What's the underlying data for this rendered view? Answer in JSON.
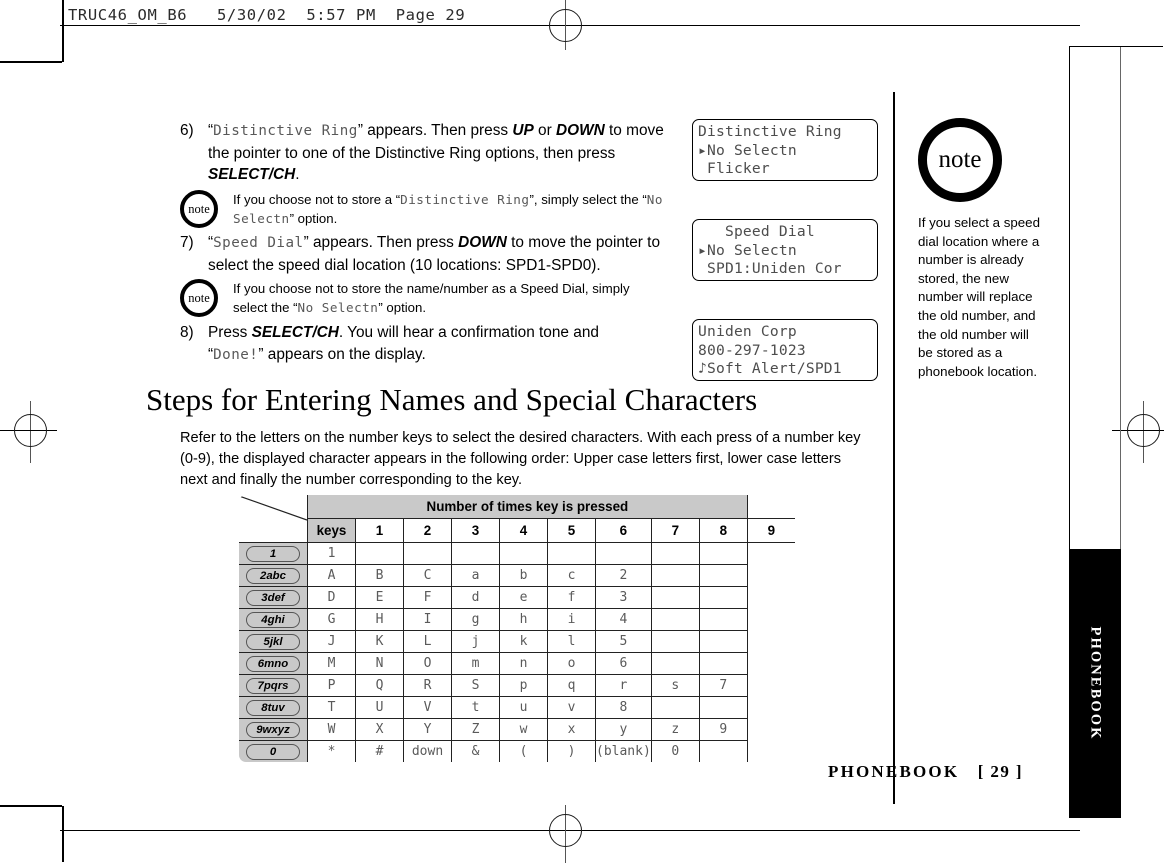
{
  "slug": "TRUC46_OM_B6   5/30/02  5:57 PM  Page 29",
  "steps": [
    {
      "num": "6)",
      "segments": [
        {
          "t": "“",
          "s": "plain"
        },
        {
          "t": "Distinctive Ring",
          "s": "lcd"
        },
        {
          "t": "” appears. Then press ",
          "s": "plain"
        },
        {
          "t": "UP",
          "s": "bolditalic"
        },
        {
          "t": " or ",
          "s": "plain"
        },
        {
          "t": "DOWN",
          "s": "bolditalic"
        },
        {
          "t": " to move the pointer to one of the Distinctive Ring options, then press ",
          "s": "plain"
        },
        {
          "t": "SELECT/CH",
          "s": "bolditalic"
        },
        {
          "t": ".",
          "s": "plain"
        }
      ]
    },
    {
      "num": "7)",
      "segments": [
        {
          "t": "“",
          "s": "plain"
        },
        {
          "t": "Speed Dial",
          "s": "lcd"
        },
        {
          "t": "” appears. Then press ",
          "s": "plain"
        },
        {
          "t": "DOWN",
          "s": "bolditalic"
        },
        {
          "t": " to move the pointer to select the speed dial location (10 locations: SPD1-SPD0).",
          "s": "plain"
        }
      ]
    },
    {
      "num": "8)",
      "segments": [
        {
          "t": "Press ",
          "s": "plain"
        },
        {
          "t": "SELECT/CH",
          "s": "bolditalic"
        },
        {
          "t": ". You will hear a confirmation tone and “",
          "s": "plain"
        },
        {
          "t": "Done!",
          "s": "lcd"
        },
        {
          "t": "” appears on the display.",
          "s": "plain"
        }
      ]
    }
  ],
  "inline_notes": [
    {
      "badge_label": "note",
      "segments": [
        {
          "t": "If you choose not to store a “",
          "s": "plain"
        },
        {
          "t": "Distinctive Ring",
          "s": "lcd"
        },
        {
          "t": "”, simply select the “",
          "s": "plain"
        },
        {
          "t": "No Selectn",
          "s": "lcd"
        },
        {
          "t": "” option.",
          "s": "plain"
        }
      ]
    },
    {
      "badge_label": "note",
      "segments": [
        {
          "t": "If you choose not to store the name/number as a Speed Dial, simply select the “",
          "s": "plain"
        },
        {
          "t": "No Selectn",
          "s": "lcd"
        },
        {
          "t": "” option.",
          "s": "plain"
        }
      ]
    }
  ],
  "lcd_panels": [
    {
      "lines": [
        "Distinctive Ring",
        "▸No Selectn",
        " Flicker"
      ]
    },
    {
      "lines": [
        "   Speed Dial",
        "▸No Selectn",
        " SPD1:Uniden Cor"
      ]
    },
    {
      "lines": [
        "Uniden Corp",
        "800-297-1023",
        "♪Soft Alert/SPD1"
      ]
    }
  ],
  "sidebar_note": {
    "badge_label": "note",
    "text": "If you select a speed dial location where a number is already stored, the new number will replace the old number, and the old number will be stored as a phonebook location."
  },
  "section": {
    "title": "Steps for Entering Names and Special Characters",
    "intro": "Refer to the letters on the number keys to select the desired characters. With each press of a number key (0-9), the displayed character appears in the following order: Upper case letters first, lower case letters next and finally the number corresponding to the key."
  },
  "char_table": {
    "band_label": "Number of times key is pressed",
    "keys_label": "keys",
    "press_columns": [
      "1",
      "2",
      "3",
      "4",
      "5",
      "6",
      "7",
      "8",
      "9"
    ],
    "rows": [
      {
        "key": "1",
        "cells": [
          "1",
          "",
          "",
          "",
          "",
          "",
          "",
          "",
          ""
        ]
      },
      {
        "key": "2abc",
        "cells": [
          "A",
          "B",
          "C",
          "a",
          "b",
          "c",
          "2",
          "",
          ""
        ]
      },
      {
        "key": "3def",
        "cells": [
          "D",
          "E",
          "F",
          "d",
          "e",
          "f",
          "3",
          "",
          ""
        ]
      },
      {
        "key": "4ghi",
        "cells": [
          "G",
          "H",
          "I",
          "g",
          "h",
          "i",
          "4",
          "",
          ""
        ]
      },
      {
        "key": "5jkl",
        "cells": [
          "J",
          "K",
          "L",
          "j",
          "k",
          "l",
          "5",
          "",
          ""
        ]
      },
      {
        "key": "6mno",
        "cells": [
          "M",
          "N",
          "O",
          "m",
          "n",
          "o",
          "6",
          "",
          ""
        ]
      },
      {
        "key": "7pqrs",
        "cells": [
          "P",
          "Q",
          "R",
          "S",
          "p",
          "q",
          "r",
          "s",
          "7"
        ]
      },
      {
        "key": "8tuv",
        "cells": [
          "T",
          "U",
          "V",
          "t",
          "u",
          "v",
          "8",
          "",
          ""
        ]
      },
      {
        "key": "9wxyz",
        "cells": [
          "W",
          "X",
          "Y",
          "Z",
          "w",
          "x",
          "y",
          "z",
          "9"
        ]
      },
      {
        "key": "0",
        "cells": [
          "*",
          "#",
          "down",
          "&",
          "(",
          ")",
          "(blank)",
          "0",
          ""
        ]
      }
    ]
  },
  "thumb_tab_label": "PHONEBOOK",
  "footer": {
    "section": "PHONEBOOK",
    "page": "[ 29 ]"
  }
}
